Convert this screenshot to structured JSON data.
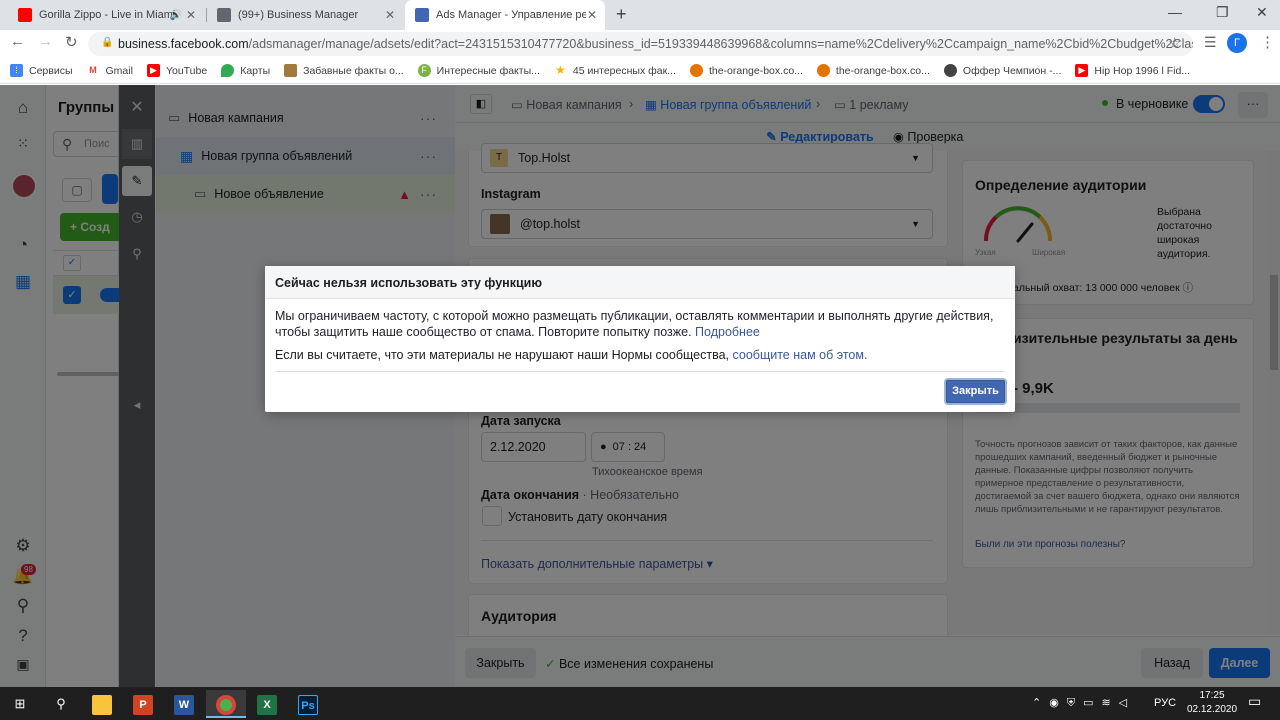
{
  "browser": {
    "tabs": [
      {
        "title": "Gorilla Zippo - Live in Miami",
        "icon": "youtube-icon"
      },
      {
        "title": "(99+) Business Manager",
        "icon": "facebook-icon"
      },
      {
        "title": "Ads Manager - Управление рекл",
        "icon": "facebook-icon"
      }
    ],
    "url_host": "business.facebook.com",
    "url_path": "/adsmanager/manage/adsets/edit?act=2431515310477720&business_id=519339448639968&columns=name%2Cdelivery%2Ccampaign_name%2Cbid%2Cbudget%2Clast_signifi...",
    "profile_letter": "Г",
    "bookmarks": [
      {
        "label": "Сервисы",
        "icon": "apps-grid-icon"
      },
      {
        "label": "Gmail",
        "icon": "gmail-icon"
      },
      {
        "label": "YouTube",
        "icon": "youtube-icon"
      },
      {
        "label": "Карты",
        "icon": "maps-pin-icon"
      },
      {
        "label": "Забавные факты о...",
        "icon": "bookmark-image-icon"
      },
      {
        "label": "Интересные факты...",
        "icon": "green-f-icon"
      },
      {
        "label": "45 интересных фак...",
        "icon": "star-icon"
      },
      {
        "label": "the-orange-box.co...",
        "icon": "orange-box-icon"
      },
      {
        "label": "the-orange-box.co...",
        "icon": "orange-box-icon"
      },
      {
        "label": "Оффер Чемпион -...",
        "icon": "champion-icon"
      },
      {
        "label": "Hip Hop 1996 l Fid...",
        "icon": "youtube-icon"
      }
    ]
  },
  "left_panel": {
    "title": "Группы о",
    "search_placeholder": "Поис",
    "create_label": "Созд"
  },
  "tree": {
    "campaign": "Новая кампания",
    "adset": "Новая группа объявлений",
    "ad": "Новое объявление"
  },
  "header": {
    "crumb_campaign": "Новая кампания",
    "crumb_adset": "Новая группа объявлений",
    "crumb_ads": "1 рекламу",
    "status": "В черновике",
    "tab_edit": "Редактировать",
    "tab_review": "Проверка"
  },
  "form": {
    "facebook_page": "Top.Holst",
    "instagram_label": "Instagram",
    "instagram_account": "@top.holst",
    "start_date_label": "Дата запуска",
    "start_date": "2.12.2020",
    "start_time": "07 : 24",
    "timezone": "Тихоокеанское время",
    "end_date_label": "Дата окончания",
    "end_date_optional": "· Необязательно",
    "set_end_date": "Установить дату окончания",
    "show_more": "Показать дополнительные параметры",
    "audience_title": "Аудитория"
  },
  "audience_definition": {
    "title": "Определение аудитории",
    "narrow": "Узкая",
    "broad": "Широкая",
    "description": "Выбрана достаточно широкая аудитория.",
    "reach": "альный охват: 13 000 000 человек",
    "gauge_level": 0.72
  },
  "daily_results": {
    "title": "изительные результаты за день",
    "value": "- 9,9K",
    "note": "Точность прогнозов зависит от таких факторов, как данные прошедших кампаний, введенный бюджет и рыночные данные. Показанные цифры позволяют получить примерное представление о результативности, достигаемой за счет вашего бюджета, однако они являются лишь приблизительными и не гарантируют результатов.",
    "feedback": "Были ли эти прогнозы полезны?"
  },
  "footer": {
    "close": "Закрыть",
    "saved": "Все изменения сохранены",
    "back": "Назад",
    "next": "Далее"
  },
  "dialog": {
    "title": "Сейчас нельзя использовать эту функцию",
    "p1": "Мы ограничиваем частоту, с которой можно размещать публикации, оставлять комментарии и выполнять другие действия, чтобы защитить наше сообщество от спама. Повторите попытку позже.",
    "p1_link": "Подробнее",
    "p2": "Если вы считаете, что эти материалы не нарушают наши Нормы сообщества,",
    "p2_link": "сообщите нам об этом.",
    "close_button": "Закрыть"
  },
  "rail": {
    "notifications_badge": "98"
  },
  "taskbar": {
    "lang": "РУС",
    "time": "17:25",
    "date": "02.12.2020"
  },
  "colors": {
    "fb_blue": "#1877f2",
    "dialog_button": "#4267b2",
    "success_green": "#42b72a"
  }
}
